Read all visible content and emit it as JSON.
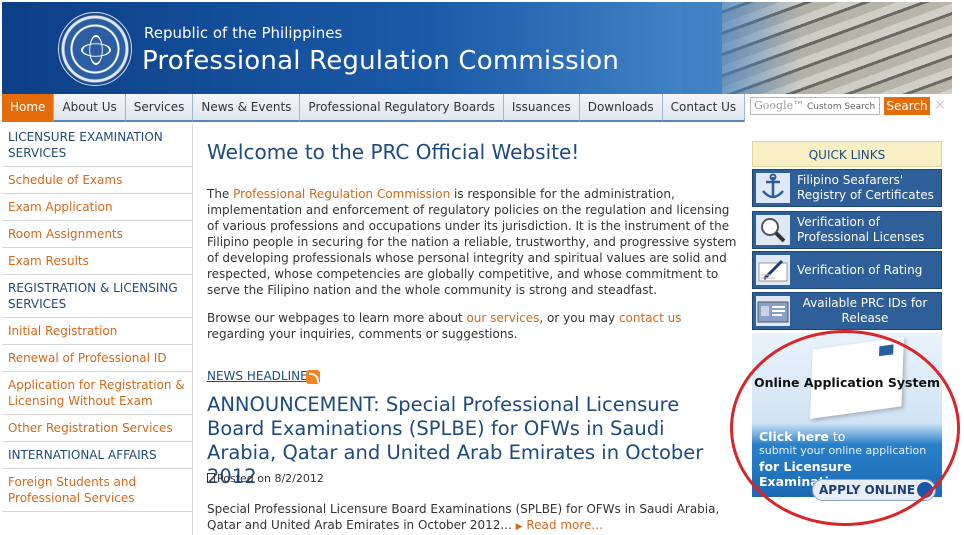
{
  "header": {
    "republic": "Republic of the Philippines",
    "commission": "Professional Regulation Commission"
  },
  "nav": {
    "tabs": [
      "Home",
      "About Us",
      "Services",
      "News & Events",
      "Professional Regulatory Boards",
      "Issuances",
      "Downloads",
      "Contact Us"
    ],
    "active": "Home"
  },
  "search": {
    "google_label": "Google™",
    "placeholder": "Custom Search",
    "button_label": "Search",
    "close_glyph": "×"
  },
  "sidebar": {
    "items": [
      {
        "label": "LICENSURE EXAMINATION SERVICES",
        "kind": "head"
      },
      {
        "label": "Schedule of Exams",
        "kind": "link"
      },
      {
        "label": "Exam Application",
        "kind": "link"
      },
      {
        "label": "Room Assignments",
        "kind": "link"
      },
      {
        "label": "Exam Results",
        "kind": "link"
      },
      {
        "label": "REGISTRATION & LICENSING SERVICES",
        "kind": "head"
      },
      {
        "label": "Initial Registration",
        "kind": "link"
      },
      {
        "label": "Renewal of Professional ID",
        "kind": "link"
      },
      {
        "label": "Application for Registration & Licensing Without Exam",
        "kind": "link"
      },
      {
        "label": "Other Registration Services",
        "kind": "link"
      },
      {
        "label": "INTERNATIONAL AFFAIRS",
        "kind": "head"
      },
      {
        "label": "Foreign Students and Professional Services",
        "kind": "link"
      }
    ]
  },
  "main": {
    "welcome": "Welcome to the PRC Official Website!",
    "para_pre": "The ",
    "para_link": "Professional Regulation Commission",
    "para_post": " is responsible for the administration, implementation and enforcement of regulatory policies on the regulation and licensing of various professions and occupations under its jurisdiction. It is the instrument of the Filipino people in securing for the nation a reliable, trustworthy, and progressive system of developing professionals whose personal integrity and spiritual values are solid and respected, whose competencies are globally competitive, and whose commitment to serve the Filipino nation and the whole community is strong and steadfast.",
    "browse_pre": "Browse our webpages to learn more about ",
    "browse_link1": "our services",
    "browse_mid": ", or you may ",
    "browse_link2": "contact us",
    "browse_post": " regarding your inquiries, comments or suggestions."
  },
  "news": {
    "headline_label": "NEWS HEADLINE",
    "title": "ANNOUNCEMENT: Special Professional Licensure Board Examinations (SPLBE) for OFWs in Saudi Arabia, Qatar and United Arab Emirates in October 2012",
    "posted": "Posted on 8/2/2012",
    "excerpt": "Special Professional Licensure Board Examinations (SPLBE) for OFWs in Saudi Arabia, Qatar and United Arab Emirates in October 2012...",
    "read_more": "Read more..."
  },
  "quick_links": {
    "title": "QUICK LINKS",
    "items": [
      {
        "label": "Filipino Seafarers' Registry of Certificates",
        "icon": "anchor-icon"
      },
      {
        "label": "Verification of Professional Licenses",
        "icon": "magnifier-icon"
      },
      {
        "label": "Verification of Rating",
        "icon": "pen-icon"
      },
      {
        "label": "Available PRC IDs for Release",
        "icon": "id-card-icon"
      }
    ]
  },
  "oas": {
    "title": "Online Application System",
    "click_bold": "Click here",
    "click_rest": " to",
    "submit": "submit your online application",
    "for": "for Licensure Examination",
    "apply": "APPLY ONLINE"
  },
  "colors": {
    "accent_orange": "#e46c0a",
    "link_orange": "#d2691e",
    "heading_blue": "#1d4a7f",
    "highlight_red": "#d8262a"
  }
}
